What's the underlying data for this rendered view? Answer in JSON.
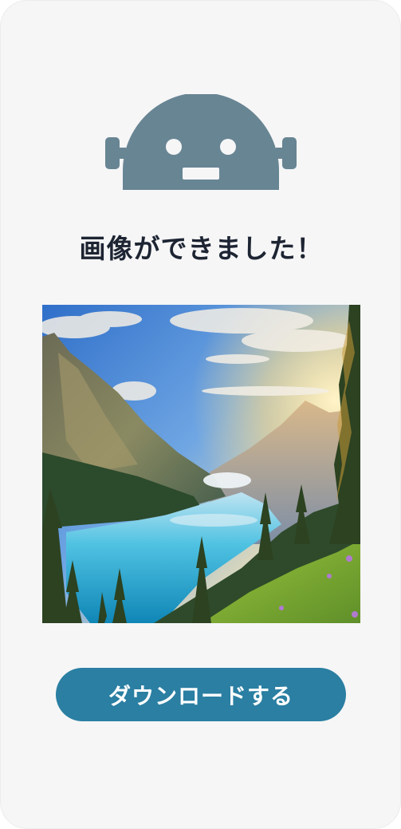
{
  "card": {
    "robot_icon": "robot-icon",
    "title": "画像ができました！",
    "image": {
      "description": "mountain-lake-landscape"
    },
    "download_button": {
      "label": "ダウンロードする"
    }
  },
  "colors": {
    "card_background": "#f6f6f7",
    "robot": "#688593",
    "title_text": "#1d2432",
    "button_background": "#2a7fa2",
    "button_text": "#ffffff"
  }
}
